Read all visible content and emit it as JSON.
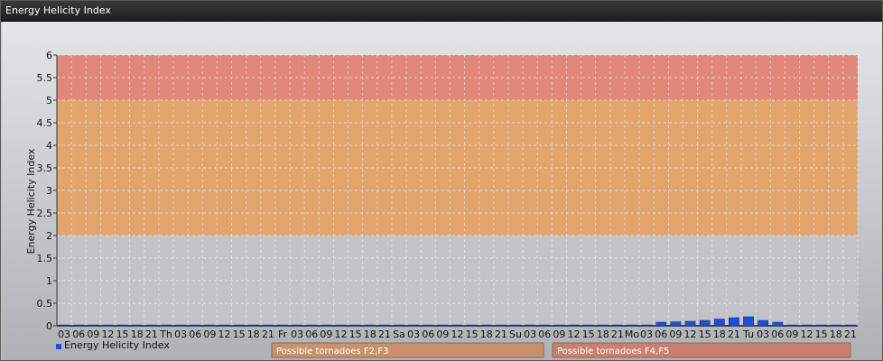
{
  "window": {
    "title": "Energy Helicity Index"
  },
  "chart_data": {
    "type": "bar",
    "ylabel": "Energy Helicity Index",
    "ylim": [
      0,
      6
    ],
    "yticks": [
      0,
      0.5,
      1,
      1.5,
      2,
      2.5,
      3,
      3.5,
      4,
      4.5,
      5,
      5.5,
      6
    ],
    "ytick_labels": [
      "0",
      "0.5",
      "1",
      "1.5",
      "2",
      "2.5",
      "3",
      "3.5",
      "4",
      "4.5",
      "5",
      "5.5",
      "6"
    ],
    "categories": [
      "03",
      "06",
      "09",
      "12",
      "15",
      "18",
      "21",
      "Th",
      "03",
      "06",
      "09",
      "12",
      "15",
      "18",
      "21",
      "Fr",
      "03",
      "06",
      "09",
      "12",
      "15",
      "18",
      "21",
      "Sa",
      "03",
      "06",
      "09",
      "12",
      "15",
      "18",
      "21",
      "Su",
      "03",
      "06",
      "09",
      "12",
      "15",
      "18",
      "21",
      "Mo",
      "03",
      "06",
      "09",
      "12",
      "15",
      "18",
      "21",
      "Tu",
      "03",
      "06",
      "09",
      "12",
      "15",
      "18",
      "21"
    ],
    "series": [
      {
        "name": "Energy Helicity Index",
        "color": "#1f4fd6",
        "values": [
          0.02,
          0.02,
          0.02,
          0.02,
          0.02,
          0.02,
          0.02,
          0.02,
          0.02,
          0.02,
          0.02,
          0.02,
          0.02,
          0.02,
          0.02,
          0.02,
          0.02,
          0.02,
          0.02,
          0.02,
          0.02,
          0.02,
          0.02,
          0.02,
          0.02,
          0.02,
          0.02,
          0.02,
          0.02,
          0.02,
          0.02,
          0.02,
          0.02,
          0.02,
          0.02,
          0.02,
          0.02,
          0.02,
          0.02,
          0.02,
          0.02,
          0.08,
          0.09,
          0.1,
          0.12,
          0.15,
          0.18,
          0.2,
          0.12,
          0.08,
          0.02,
          0.02,
          0.02,
          0.02,
          0.02
        ]
      }
    ],
    "bands": [
      {
        "from": 0,
        "to": 2,
        "color": "#c2c3c8"
      },
      {
        "from": 2,
        "to": 5,
        "color": "#e2a56e"
      },
      {
        "from": 5,
        "to": 6,
        "color": "#e0887a"
      }
    ],
    "legend": {
      "placement": "bottom-left",
      "label": "Energy Helicity Index",
      "color": "#1f4fd6"
    },
    "band_legend": [
      {
        "label": "Possible tornadoes F2,F3",
        "color": "#c9906a"
      },
      {
        "label": "Possible tornadoes F4,F5",
        "color": "#cc7f6f"
      }
    ],
    "grid": true
  }
}
